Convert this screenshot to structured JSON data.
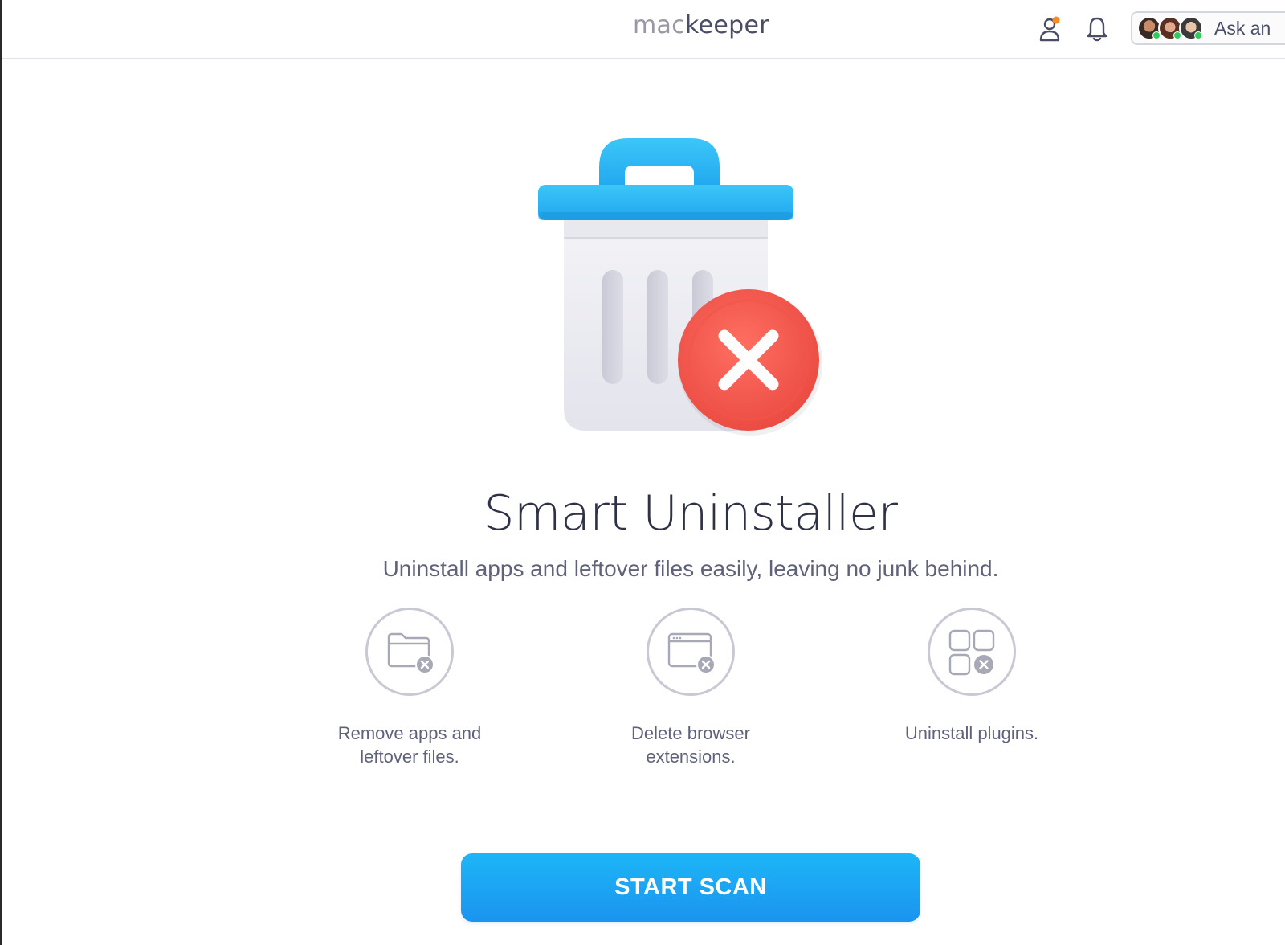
{
  "header": {
    "logo_part1": "mac",
    "logo_part2": "keeper",
    "ask_label": "Ask an"
  },
  "main": {
    "title": "Smart Uninstaller",
    "subtitle": "Uninstall apps and leftover files easily, leaving no junk behind.",
    "features": [
      {
        "icon": "folder-remove-icon",
        "label_line1": "Remove apps and",
        "label_line2": "leftover files."
      },
      {
        "icon": "browser-window-remove-icon",
        "label_line1": "Delete browser extensions.",
        "label_line2": ""
      },
      {
        "icon": "plugins-grid-remove-icon",
        "label_line1": "Uninstall plugins.",
        "label_line2": ""
      }
    ],
    "start_button": "START SCAN"
  },
  "colors": {
    "accent": "#1b9ff3",
    "trash_lid": "#2bb6f3",
    "error_badge": "#f25449",
    "text_dark": "#2f3146",
    "text_muted": "#5f6278"
  }
}
